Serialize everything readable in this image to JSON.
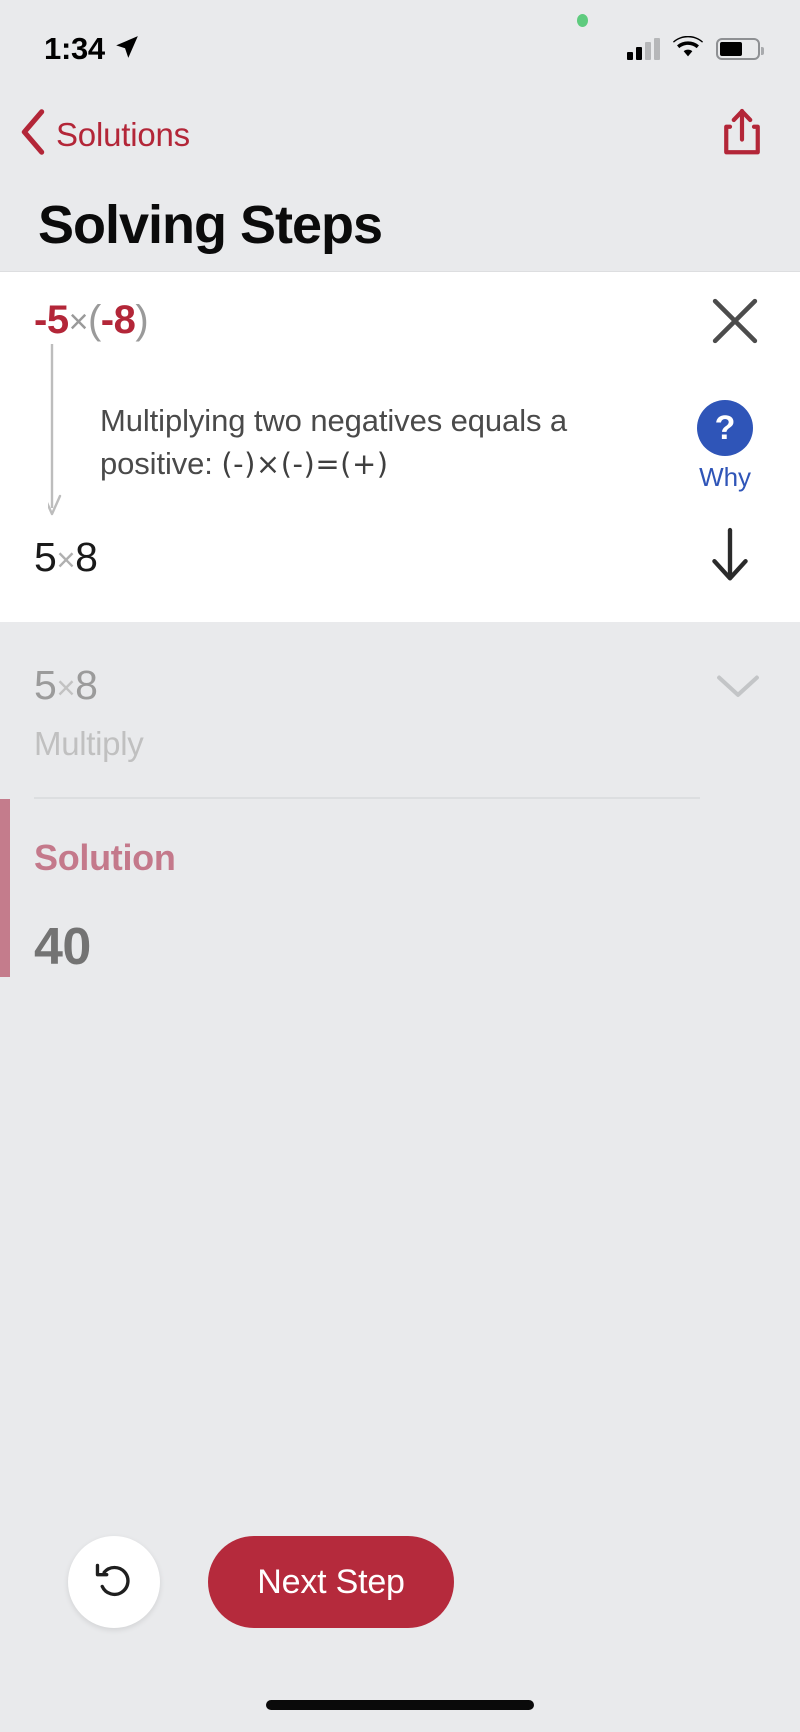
{
  "status_bar": {
    "time": "1:34",
    "location_icon": "location-arrow-icon",
    "cellular_icon": "cellular-bars-icon",
    "wifi_icon": "wifi-icon",
    "battery_icon": "battery-icon",
    "recording_dot": "green-privacy-dot"
  },
  "nav": {
    "back_label": "Solutions",
    "back_icon": "chevron-left-icon",
    "share_icon": "share-icon"
  },
  "header": {
    "title": "Solving Steps"
  },
  "active_step": {
    "expression": {
      "lead_sign": "-",
      "lead_number": "5",
      "operator": "×",
      "open_paren": "(",
      "second_sign": "-",
      "second_number": "8",
      "close_paren": ")",
      "full_text": "-5×(-8)"
    },
    "close_icon": "close-icon",
    "explanation_text": "Multiplying two negatives equals a positive: ",
    "explanation_line1": "Multiplying two negatives equals a",
    "explanation_line2_prefix": "positive: ",
    "explanation_math": "(-)×(-)=(+)",
    "why_symbol": "?",
    "why_label": "Why",
    "why_icon": "question-mark-icon",
    "result_left": "5",
    "result_operator": "×",
    "result_right": "8",
    "result_full": "5×8",
    "down_icon": "arrow-down-icon",
    "flow_arrow_icon": "flow-arrow-down-icon"
  },
  "next_step_preview": {
    "expression_left": "5",
    "expression_operator": "×",
    "expression_right": "8",
    "expression_full": "5×8",
    "operation_label": "Multiply",
    "chevron_icon": "chevron-down-icon"
  },
  "solution": {
    "title": "Solution",
    "value": "40"
  },
  "bottom_actions": {
    "undo_icon": "undo-arrow-icon",
    "undo_glyph": "↺",
    "next_step_label": "Next Step"
  },
  "colors": {
    "brand_red": "#b32638",
    "button_red": "#b52a3c",
    "solution_pink": "#c4798b",
    "why_blue": "#2f55b8",
    "page_bg": "#e9eaec",
    "card_bg": "#ffffff"
  }
}
